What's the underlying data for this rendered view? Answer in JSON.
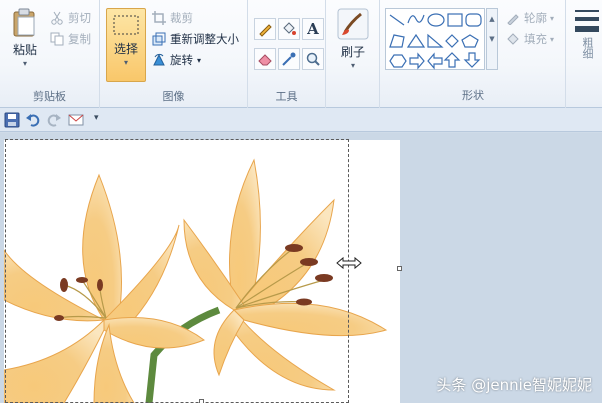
{
  "clipboard": {
    "paste_label": "粘贴",
    "cut_label": "剪切",
    "copy_label": "复制",
    "group_label": "剪贴板"
  },
  "image": {
    "select_label": "选择",
    "crop_label": "裁剪",
    "resize_label": "重新调整大小",
    "rotate_label": "旋转",
    "group_label": "图像"
  },
  "tools": {
    "group_label": "工具",
    "icons": [
      "pencil-icon",
      "fill-icon",
      "text-icon",
      "eraser-icon",
      "color-picker-icon",
      "magnifier-icon"
    ]
  },
  "brushes": {
    "label": "刷子"
  },
  "shapes": {
    "outline_label": "轮廓",
    "fill_label": "填充",
    "group_label": "形状"
  },
  "size": {
    "label": "粗细"
  },
  "watermark": "头条 @jennie智妮妮妮",
  "colors": {
    "accent": "#f9c76a",
    "ribbon_bg": "#f4f7fb",
    "workspace": "#cbd8e6"
  }
}
